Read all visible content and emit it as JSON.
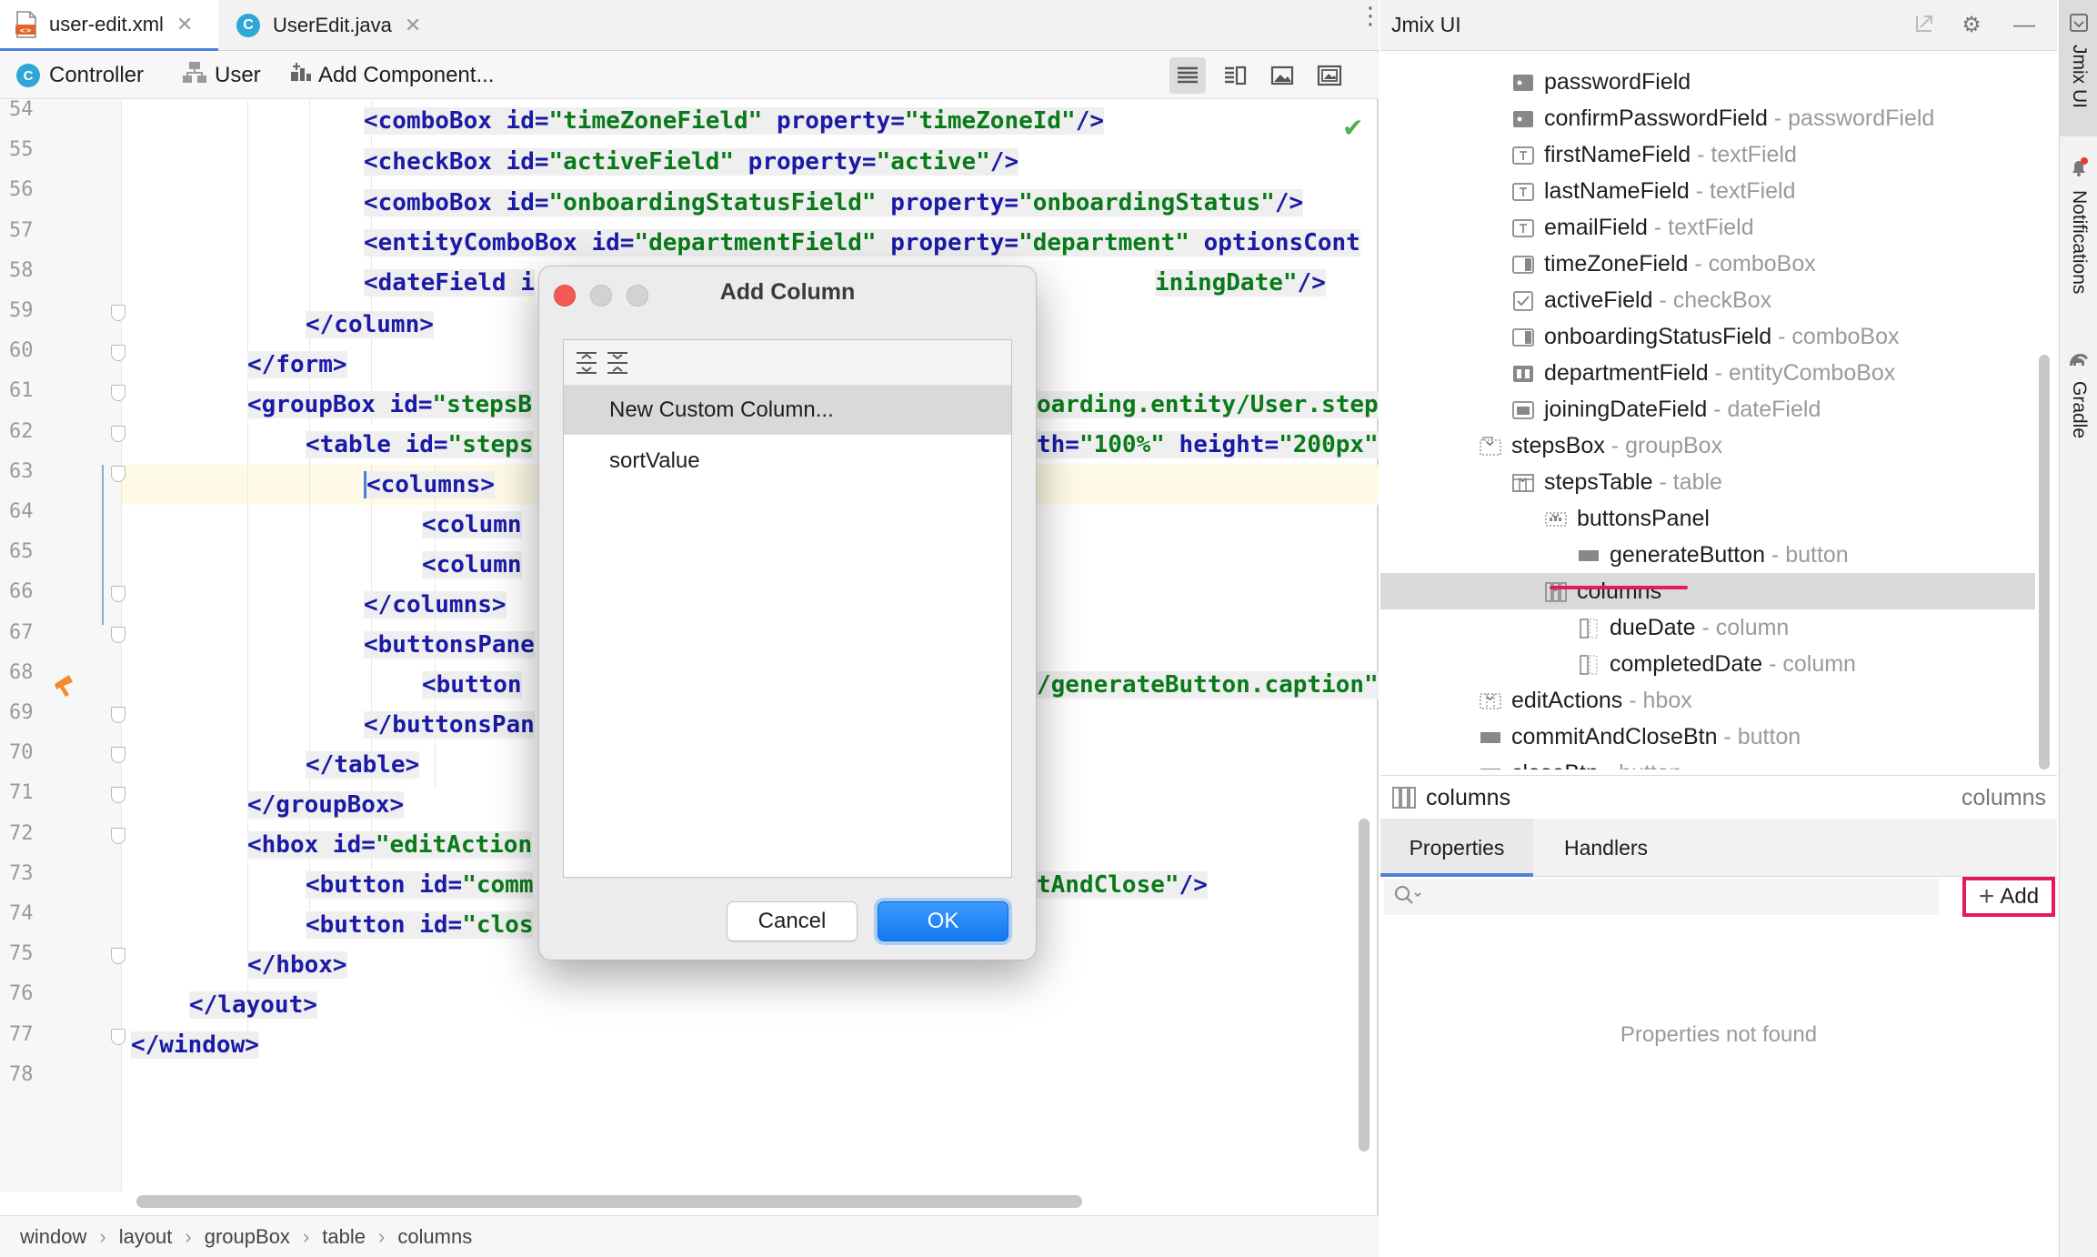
{
  "tabs": [
    {
      "label": "user-edit.xml",
      "active": true,
      "icon": "xml-file-icon"
    },
    {
      "label": "UserEdit.java",
      "active": false,
      "icon": "java-class-icon"
    }
  ],
  "toolbar": {
    "controller_label": "Controller",
    "user_label": "User",
    "add_component_label": "Add Component..."
  },
  "line_numbers": [
    "54",
    "55",
    "56",
    "57",
    "58",
    "59",
    "60",
    "61",
    "62",
    "63",
    "64",
    "65",
    "66",
    "67",
    "68",
    "69",
    "70",
    "71",
    "72",
    "73",
    "74",
    "75",
    "76",
    "77",
    "78"
  ],
  "code": {
    "l54": {
      "tag": "<comboBox",
      "a1": " id=",
      "v1": "\"timeZoneField\"",
      "a2": " property=",
      "v2": "\"timeZoneId\"",
      "end": "/>"
    },
    "l55": {
      "tag": "<checkBox",
      "a1": " id=",
      "v1": "\"activeField\"",
      "a2": " property=",
      "v2": "\"active\"",
      "end": "/>"
    },
    "l56": {
      "tag": "<comboBox",
      "a1": " id=",
      "v1": "\"onboardingStatusField\"",
      "a2": " property=",
      "v2": "\"onboardingStatus\"",
      "end": "/>"
    },
    "l57": {
      "tag": "<entityComboBox",
      "a1": " id=",
      "v1": "\"departmentField\"",
      "a2": " property=",
      "v2": "\"department\"",
      "a3": " optionsCont"
    },
    "l58": {
      "tag": "<dateField",
      "a1": " i",
      "tail": "iningDate\"",
      "end": "/>"
    },
    "l59": {
      "tag": "</column>"
    },
    "l60": {
      "tag": "</form>"
    },
    "l61": {
      "tag": "<groupBox",
      "a1": " id=",
      "v1": "\"stepsB",
      "tail": "oarding.entity/User.step"
    },
    "l62": {
      "tag": "<table",
      "a1": " id=",
      "v1": "\"steps",
      "a2": "th=",
      "v2": "\"100%\"",
      "a3": " height=",
      "v3": "\"200px\""
    },
    "l63": {
      "tag": "<columns>"
    },
    "l64": {
      "tag": "<column"
    },
    "l65": {
      "tag": "<column"
    },
    "l66": {
      "tag": "</columns>"
    },
    "l67": {
      "tag": "<buttonsPane"
    },
    "l68": {
      "tag": "<button",
      "tail": "/generateButton.caption\""
    },
    "l69": {
      "tag": "</buttonsPan"
    },
    "l70": {
      "tag": "</table>"
    },
    "l71": {
      "tag": "</groupBox>"
    },
    "l72": {
      "tag": "<hbox",
      "a1": " id=",
      "v1": "\"editAction"
    },
    "l73": {
      "tag": "<button",
      "a1": " id=",
      "v1": "\"comm",
      "tail": "tAndClose\"",
      "end": "/>"
    },
    "l74": {
      "tag": "<button",
      "a1": " id=",
      "v1": "\"clos"
    },
    "l75": {
      "tag": "</hbox>"
    },
    "l76": {
      "tag": "</layout>"
    },
    "l77": {
      "tag": "</window>"
    }
  },
  "dialog": {
    "title": "Add Column",
    "items": [
      "New Custom Column...",
      "sortValue"
    ],
    "selected_index": 0,
    "cancel_label": "Cancel",
    "ok_label": "OK"
  },
  "breadcrumb": [
    "window",
    "layout",
    "groupBox",
    "table",
    "columns"
  ],
  "jmix_panel": {
    "title": "Jmix UI",
    "tree": [
      {
        "name": "passwordField",
        "type": "",
        "icon": "password-field-icon"
      },
      {
        "name": "confirmPasswordField",
        "type": "passwordField",
        "icon": "password-field-icon"
      },
      {
        "name": "firstNameField",
        "type": "textField",
        "icon": "text-field-icon"
      },
      {
        "name": "lastNameField",
        "type": "textField",
        "icon": "text-field-icon"
      },
      {
        "name": "emailField",
        "type": "textField",
        "icon": "text-field-icon"
      },
      {
        "name": "timeZoneField",
        "type": "comboBox",
        "icon": "combobox-icon"
      },
      {
        "name": "activeField",
        "type": "checkBox",
        "icon": "checkbox-icon"
      },
      {
        "name": "onboardingStatusField",
        "type": "comboBox",
        "icon": "combobox-icon"
      },
      {
        "name": "departmentField",
        "type": "entityComboBox",
        "icon": "entity-combobox-icon"
      },
      {
        "name": "joiningDateField",
        "type": "dateField",
        "icon": "date-field-icon"
      },
      {
        "name": "stepsBox",
        "type": "groupBox",
        "icon": "groupbox-icon"
      },
      {
        "name": "stepsTable",
        "type": "table",
        "icon": "table-icon"
      },
      {
        "name": "buttonsPanel",
        "type": "",
        "icon": "buttons-panel-icon"
      },
      {
        "name": "generateButton",
        "type": "button",
        "icon": "button-icon"
      },
      {
        "name": "columns",
        "type": "",
        "icon": "columns-icon"
      },
      {
        "name": "dueDate",
        "type": "column",
        "icon": "column-icon"
      },
      {
        "name": "completedDate",
        "type": "column",
        "icon": "column-icon"
      },
      {
        "name": "editActions",
        "type": "hbox",
        "icon": "hbox-icon"
      },
      {
        "name": "commitAndCloseBtn",
        "type": "button",
        "icon": "button-icon"
      },
      {
        "name": "closeBtn",
        "type": "button",
        "icon": "button-icon"
      }
    ],
    "type_separator": " - ",
    "selected_component": "columns",
    "selected_type": "columns",
    "properties_tab": "Properties",
    "handlers_tab": "Handlers",
    "search_placeholder": "",
    "add_label": "Add",
    "empty_text": "Properties not found"
  },
  "side_tabs": [
    "Jmix UI",
    "Notifications",
    "Gradle"
  ],
  "colors": {
    "accent": "#4e7fd8",
    "highlight": "#e8185a",
    "ok_button": "#1478f0",
    "xml_tag": "#1a1aa6",
    "xml_string": "#097a19"
  }
}
